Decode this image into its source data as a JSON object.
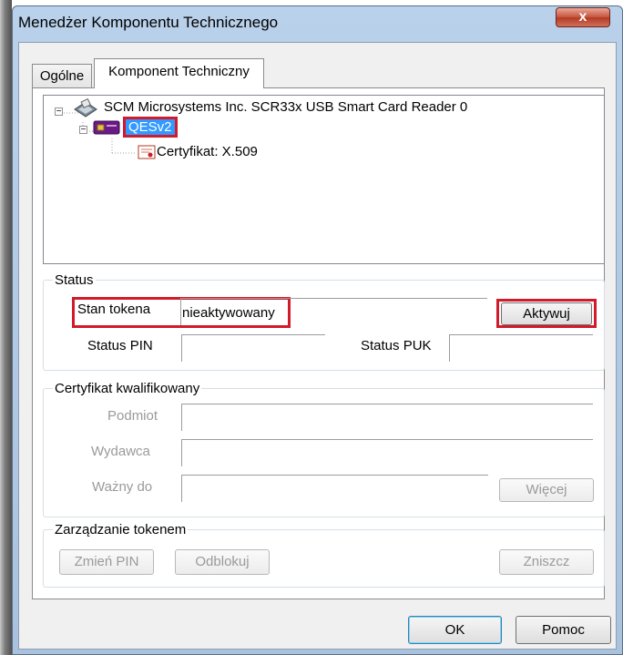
{
  "window": {
    "title": "Menedżer Komponentu Technicznego",
    "close_glyph": "x"
  },
  "tabs": [
    {
      "label": "Ogólne",
      "selected": false
    },
    {
      "label": "Komponent Techniczny",
      "selected": true
    }
  ],
  "tree": {
    "reader": {
      "label": "SCM Microsystems Inc. SCR33x USB Smart Card Reader 0",
      "icon": "card-reader-icon"
    },
    "token": {
      "label": "QESv2",
      "icon": "smart-card-icon",
      "selected": true
    },
    "certificate": {
      "label": "Certyfikat: X.509",
      "icon": "certificate-icon"
    }
  },
  "status": {
    "legend": "Status",
    "token_state_label": "Stan tokena",
    "token_state_value": "nieaktywowany",
    "activate_button": "Aktywuj",
    "pin_status_label": "Status PIN",
    "pin_status_value": "",
    "puk_status_label": "Status PUK",
    "puk_status_value": ""
  },
  "qualified_cert": {
    "legend": "Certyfikat kwalifikowany",
    "subject_label": "Podmiot",
    "issuer_label": "Wydawca",
    "valid_to_label": "Ważny do",
    "more_button": "Więcej"
  },
  "token_management": {
    "legend": "Zarządzanie tokenem",
    "change_pin_button": "Zmień PIN",
    "unblock_button": "Odblokuj",
    "destroy_button": "Zniszcz"
  },
  "footer": {
    "ok_button": "OK",
    "help_button": "Pomoc"
  },
  "colors": {
    "highlight_red": "#d11a2a",
    "selection_blue": "#3399ff"
  }
}
